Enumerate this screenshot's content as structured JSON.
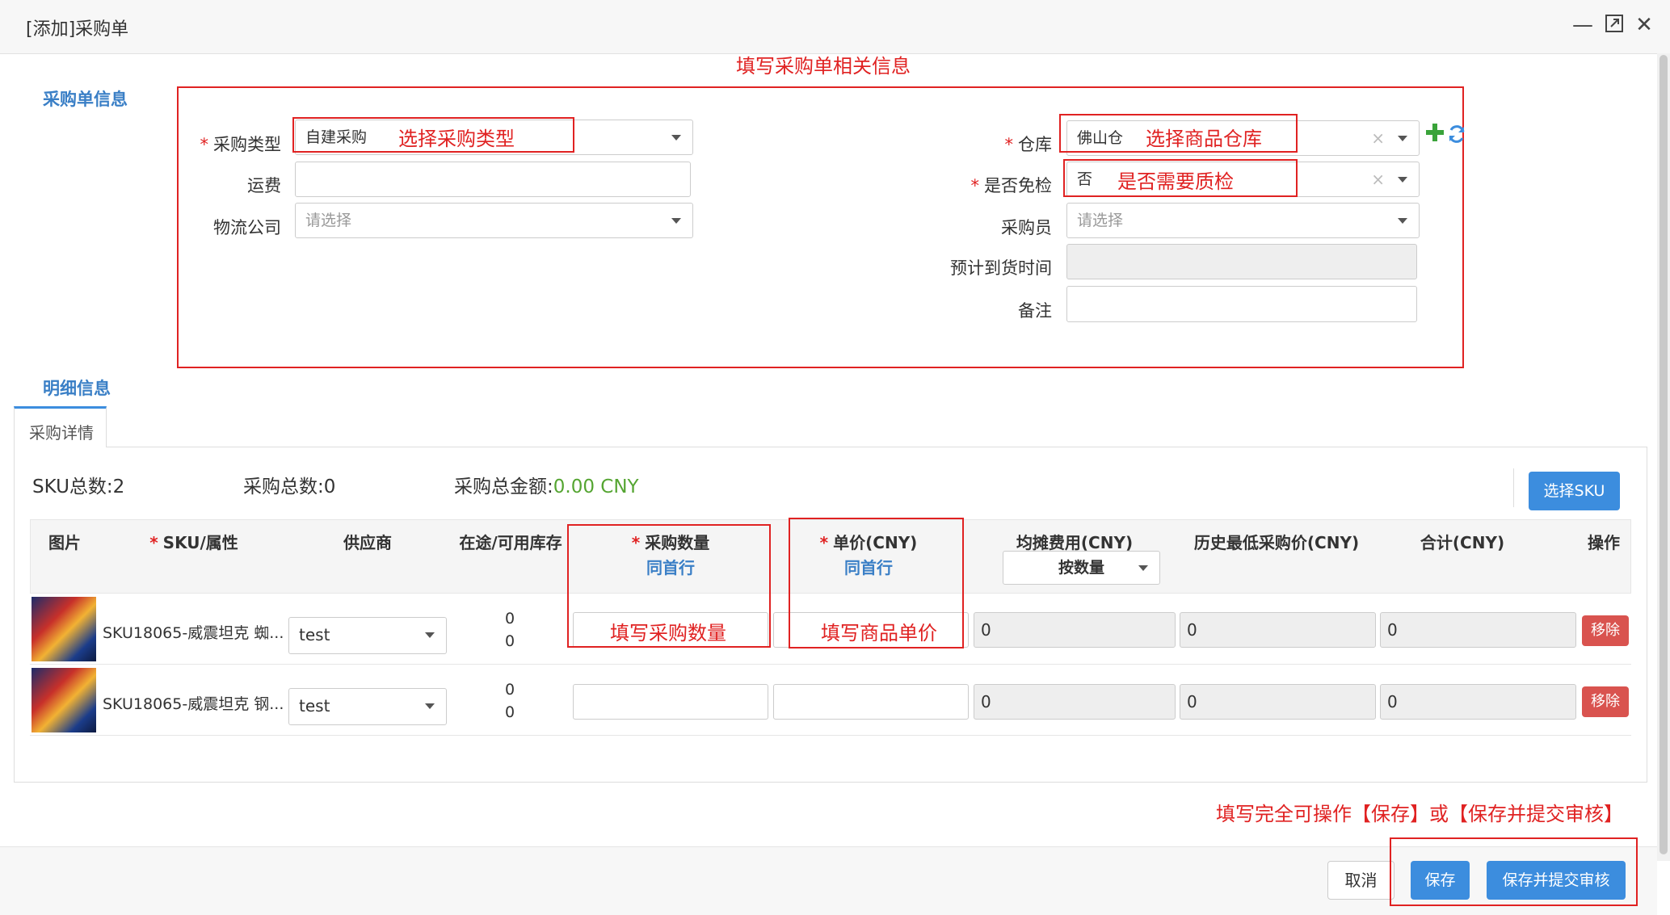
{
  "window": {
    "title": "[添加]采购单"
  },
  "annotations": {
    "top": "填写采购单相关信息",
    "purchase_type": "选择采购类型",
    "warehouse": "选择商品仓库",
    "inspection": "是否需要质检",
    "qty": "填写采购数量",
    "price": "填写商品单价",
    "footer": "填写完全可操作【保存】或【保存并提交审核】"
  },
  "sections": {
    "order_info": "采购单信息",
    "detail_info": "明细信息"
  },
  "form": {
    "left": {
      "purchase_type": {
        "label": "采购类型",
        "value": "自建采购"
      },
      "freight": {
        "label": "运费",
        "value": ""
      },
      "logistics": {
        "label": "物流公司",
        "placeholder": "请选择"
      }
    },
    "right": {
      "warehouse": {
        "label": "仓库",
        "value": "佛山仓"
      },
      "exempt": {
        "label": "是否免检",
        "value": "否"
      },
      "buyer": {
        "label": "采购员",
        "placeholder": "请选择"
      },
      "eta": {
        "label": "预计到货时间",
        "value": ""
      },
      "remark": {
        "label": "备注",
        "value": ""
      }
    }
  },
  "tabs": [
    {
      "label": "采购详情"
    }
  ],
  "summary": {
    "sku_label": "SKU总数:",
    "sku_value": "2",
    "qty_label": "采购总数:",
    "qty_value": "0",
    "amount_label": "采购总金额:",
    "amount_value": "0.00 CNY"
  },
  "select_sku_label": "选择SKU",
  "table": {
    "headers": {
      "image": "图片",
      "sku": "SKU/属性",
      "supplier": "供应商",
      "stock": "在途/可用库存",
      "qty": "采购数量",
      "qty_sub": "同首行",
      "price": "单价(CNY)",
      "price_sub": "同首行",
      "alloc": "均摊费用(CNY)",
      "alloc_select": "按数量",
      "hist": "历史最低采购价(CNY)",
      "total": "合计(CNY)",
      "op": "操作"
    },
    "rows": [
      {
        "sku": "SKU18065-威震坦克 蜘...",
        "supplier": "test",
        "in_transit": "0",
        "available": "0",
        "alloc": "0",
        "hist": "0",
        "total": "0",
        "remove": "移除"
      },
      {
        "sku": "SKU18065-威震坦克 钢...",
        "supplier": "test",
        "in_transit": "0",
        "available": "0",
        "alloc": "0",
        "hist": "0",
        "total": "0",
        "remove": "移除"
      }
    ]
  },
  "footer": {
    "cancel": "取消",
    "save": "保存",
    "save_submit": "保存并提交审核"
  },
  "colors": {
    "accent": "#3c8dde",
    "danger": "#d9534f",
    "annotation": "#e02222",
    "amount": "#55a532"
  },
  "icons": {
    "add": "plus-icon",
    "refresh": "refresh-icon",
    "minimize": "minimize-icon",
    "maximize": "maximize-icon",
    "close": "close-icon"
  }
}
